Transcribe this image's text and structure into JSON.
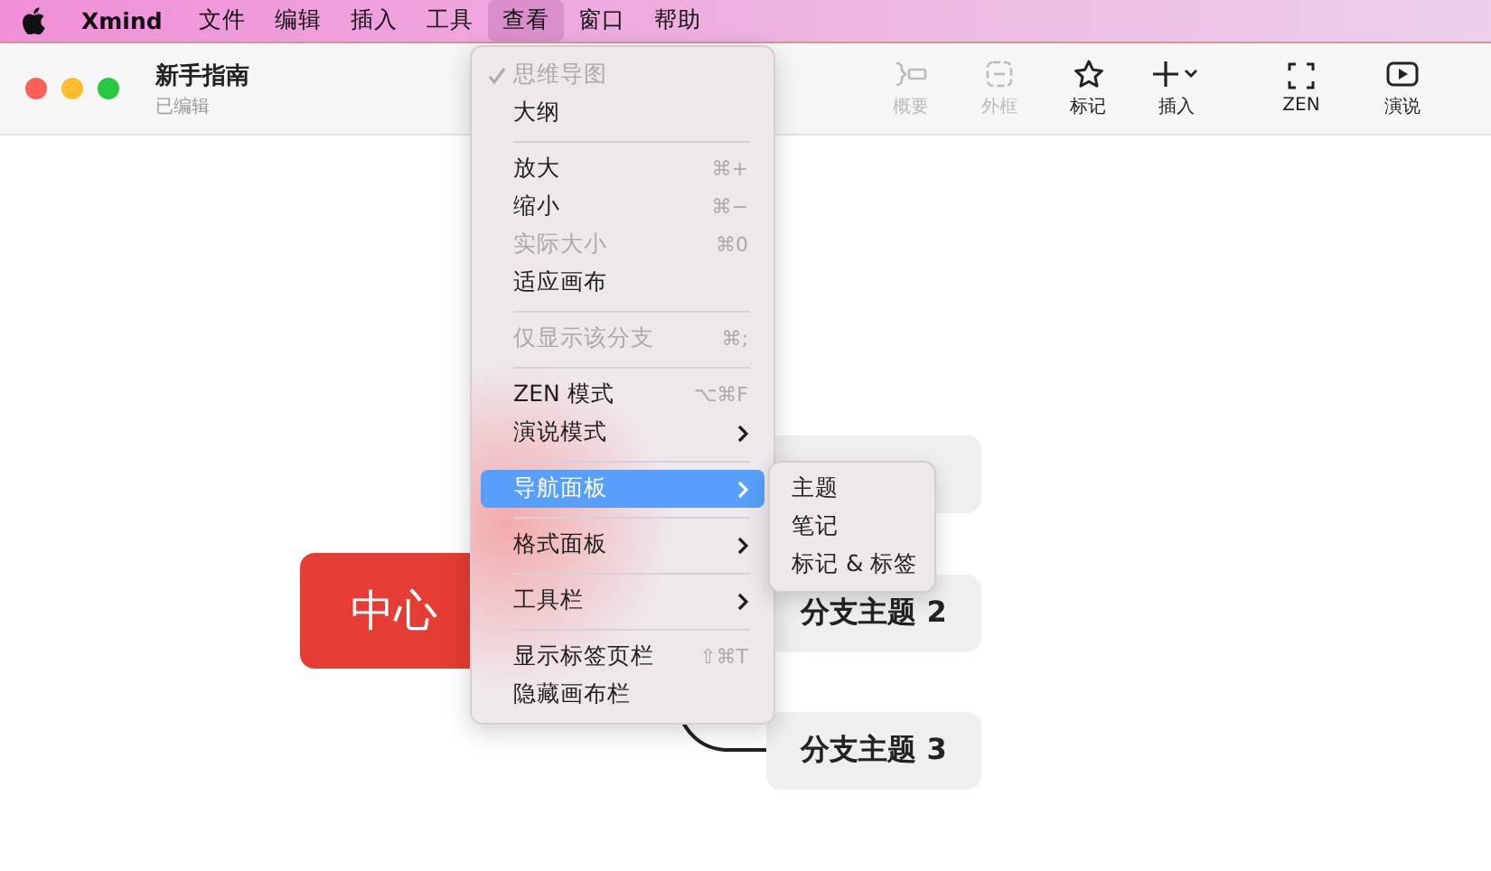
{
  "menubar": {
    "items": [
      {
        "label": "Xmind",
        "kind": "app",
        "selected": false
      },
      {
        "label": "文件",
        "kind": "menu",
        "selected": false
      },
      {
        "label": "编辑",
        "kind": "menu",
        "selected": false
      },
      {
        "label": "插入",
        "kind": "menu",
        "selected": false
      },
      {
        "label": "工具",
        "kind": "menu",
        "selected": false
      },
      {
        "label": "查看",
        "kind": "menu",
        "selected": true
      },
      {
        "label": "窗口",
        "kind": "menu",
        "selected": false
      },
      {
        "label": "帮助",
        "kind": "menu",
        "selected": false
      }
    ]
  },
  "window": {
    "title": "新手指南",
    "subtitle": "已编辑"
  },
  "toolbar": {
    "items": [
      {
        "label": "概要",
        "disabled": true
      },
      {
        "label": "外框",
        "disabled": true
      },
      {
        "label": "标记",
        "disabled": false
      },
      {
        "label": "插入",
        "disabled": false
      },
      {
        "label": "ZEN",
        "disabled": false
      },
      {
        "label": "演说",
        "disabled": false
      }
    ]
  },
  "canvas": {
    "central_topic": "中心",
    "branches": [
      "分支主题 2",
      "分支主题 3"
    ]
  },
  "view_menu": {
    "items": [
      {
        "kind": "item",
        "label": "思维导图",
        "checked": true,
        "disabled": true,
        "selected": false,
        "submenu": false
      },
      {
        "kind": "item",
        "label": "大纲",
        "checked": false,
        "disabled": false,
        "selected": false,
        "submenu": false
      },
      {
        "kind": "separator"
      },
      {
        "kind": "item",
        "label": "放大",
        "shortcut": "⌘+",
        "checked": false,
        "disabled": false,
        "selected": false,
        "submenu": false
      },
      {
        "kind": "item",
        "label": "缩小",
        "shortcut": "⌘−",
        "checked": false,
        "disabled": false,
        "selected": false,
        "submenu": false
      },
      {
        "kind": "item",
        "label": "实际大小",
        "shortcut": "⌘0",
        "checked": false,
        "disabled": true,
        "selected": false,
        "submenu": false
      },
      {
        "kind": "item",
        "label": "适应画布",
        "checked": false,
        "disabled": false,
        "selected": false,
        "submenu": false
      },
      {
        "kind": "separator"
      },
      {
        "kind": "item",
        "label": "仅显示该分支",
        "shortcut": "⌘;",
        "checked": false,
        "disabled": true,
        "selected": false,
        "submenu": false
      },
      {
        "kind": "separator"
      },
      {
        "kind": "item",
        "label": "ZEN 模式",
        "shortcut": "⌥⌘F",
        "checked": false,
        "disabled": false,
        "selected": false,
        "submenu": false
      },
      {
        "kind": "item",
        "label": "演说模式",
        "checked": false,
        "disabled": false,
        "selected": false,
        "submenu": true
      },
      {
        "kind": "separator"
      },
      {
        "kind": "item",
        "label": "导航面板",
        "checked": false,
        "disabled": false,
        "selected": true,
        "submenu": true
      },
      {
        "kind": "separator"
      },
      {
        "kind": "item",
        "label": "格式面板",
        "checked": false,
        "disabled": false,
        "selected": false,
        "submenu": true
      },
      {
        "kind": "separator"
      },
      {
        "kind": "item",
        "label": "工具栏",
        "checked": false,
        "disabled": false,
        "selected": false,
        "submenu": true
      },
      {
        "kind": "separator"
      },
      {
        "kind": "item",
        "label": "显示标签页栏",
        "shortcut": "⇧⌘T",
        "checked": false,
        "disabled": false,
        "selected": false,
        "submenu": false
      },
      {
        "kind": "item",
        "label": "隐藏画布栏",
        "checked": false,
        "disabled": false,
        "selected": false,
        "submenu": false
      }
    ]
  },
  "submenu": {
    "items": [
      "主题",
      "笔记",
      "标记 & 标签"
    ]
  }
}
